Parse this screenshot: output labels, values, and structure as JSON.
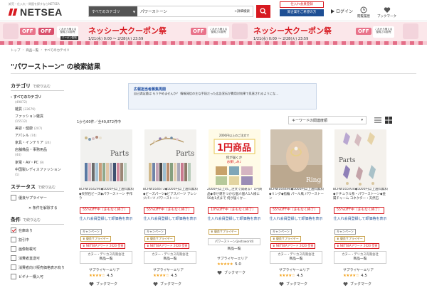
{
  "header": {
    "tagline": "卸売・仕入れ・問屋を探すならNETSEA",
    "logo": "NETSEA",
    "search_category": "すべてのカテゴリ",
    "search_value": "パワーストーン",
    "advanced_search": "+詳細検索",
    "register_top": "仕入れ会員登録",
    "register_bottom": "卸企業をご希望の方",
    "login": "ログイン",
    "history": "閲覧履歴",
    "bookmark": "ブックマーク"
  },
  "banner": {
    "off_label": "OFF",
    "coupon_title": "ネッシー大クーポン祭",
    "coupon_date": "1/21(水) 0:00 ～ 2/28(火) 23:59",
    "tag_text": "これから使える優秀さの卸売",
    "tag_foot": "クーポン配布"
  },
  "breadcrumb": [
    "トップ",
    "商品一覧",
    "すべてのカテゴリ"
  ],
  "page_title": "\"パワーストーン\" の検索結果",
  "sidebar": {
    "category_heading": "カテゴリ",
    "category_sub": "で絞り込む",
    "all_categories": "すべてのカテゴリ",
    "all_count": "(49872)",
    "categories": [
      {
        "label": "雑貨",
        "count": "(33679)"
      },
      {
        "label": "ファッション雑貨",
        "count": "(15512)"
      },
      {
        "label": "美容・健康",
        "count": "(207)"
      },
      {
        "label": "アパレル",
        "count": "(74)"
      },
      {
        "label": "家具・インテリア",
        "count": "(24)"
      },
      {
        "label": "店舗備品・事務用品",
        "count": "(44)"
      },
      {
        "label": "家電・AV・PC",
        "count": "(9)"
      },
      {
        "label": "中国製レディスファッション",
        "count": "(1)"
      }
    ],
    "status_heading": "ステータス",
    "status_sub": "で絞り込む",
    "preferred_supplier": "優良サプライヤー",
    "condition_toggle": "条件を解除する",
    "conditions_heading": "条件",
    "conditions_sub": "で絞り込む",
    "conditions": [
      {
        "label": "在庫あり",
        "checked": true
      },
      {
        "label": "割引中",
        "checked": false
      },
      {
        "label": "画像転載可",
        "checked": false
      },
      {
        "label": "消費者直送可",
        "checked": false
      },
      {
        "label": "消費者向け販売価格表示有り",
        "checked": false
      },
      {
        "label": "ビギナー購入可",
        "checked": false
      }
    ]
  },
  "ad": {
    "title": "広報担当者募集再開",
    "desc": "自己満足量は もうやめませんか？ 情報発信の主な手段だった広告宣伝が費用対効果で見直されるようにな..."
  },
  "results": {
    "count_text": "1から60件／全49,872件中",
    "sort_label": "キーワードの関連度順"
  },
  "products": [
    {
      "name": "BLHW164294◆5000円以上送料無料◆天然石ビーズ◆パワーストーン 手作り",
      "sale": "55%OFF中（まもなく終了）",
      "member": "仕入れ会員登録して卸価格を表示",
      "tag1": "キャンペーン",
      "tag2": "優良サプライヤー",
      "tag3": "NETSEAアワード 2020 受賞",
      "shop_name": "カヌー・デリカス有限会社",
      "shop_button": "商品一覧",
      "supplier": "サプライヤーエリア",
      "rating": "4.5",
      "bookmark": "ブックマーク"
    },
    {
      "name": "BLHW164673◆5000円以上送料無料◆ビーズパーツ◆ビアスパーツ アレンジパーツ パワーストーン",
      "sale": "55%OFF中（まもなく終了）",
      "member": "仕入れ会員登録して卸価格を表示",
      "tag1": "キャンペーン",
      "tag2": "優良サプライヤー",
      "tag3": "NETSEAアワード 2020 受賞",
      "shop_name": "カヌー・デリカス有限会社",
      "shop_button": "商品一覧",
      "supplier": "サプライヤーエリア",
      "rating": "4.5",
      "bookmark": "ブックマーク"
    },
    {
      "name": "2000円以上のご注文で開運る！1円商品◆幸せ運をつかむ個人個人1人様に50お1点まで 何が届くか...",
      "sale": "10%OFF中（まもなく終了）",
      "member": "仕入れ会員登録して卸価格を表示",
      "tag1": "優良サプライヤー",
      "tag2": "パワーストーン(jestsworld)",
      "tag3": "",
      "shop_name": "",
      "shop_button": "商品一覧",
      "supplier": "サプライヤーエリア",
      "rating": "5.0",
      "bookmark": "ブックマーク"
    },
    {
      "name": "BLHW164494◆5000円以上送料無料◆リング◆指輪 パール風 パワーストーン",
      "sale": "55%OFF中（まもなく終了）",
      "member": "仕入れ会員登録して卸価格を表示",
      "tag1": "キャンペーン",
      "tag2": "優良サプライヤー",
      "tag3": "NETSEAアワード 2020 受賞",
      "shop_name": "カヌー・デリカス有限会社",
      "shop_button": "商品一覧",
      "supplier": "サプライヤーエリア",
      "rating": "4.5",
      "bookmark": "ブックマーク"
    },
    {
      "name": "BLHW165934◆5000円以上送料無料◆ナチュラル系・パワーストーン◆金属チャーム コネクター・天然石",
      "sale": "55%OFF中（まもなく終了）",
      "member": "仕入れ会員登録して卸価格を表示",
      "tag1": "キャンペーン",
      "tag2": "優良サプライヤー",
      "tag3": "NETSEAアワード 2020 受賞",
      "shop_name": "カヌー・デリカス有限会社",
      "shop_button": "商品一覧",
      "supplier": "サプライヤーエリア",
      "rating": "4.5",
      "bookmark": "ブックマーク"
    }
  ],
  "image_labels": {
    "parts": "Parts",
    "ring": "Ring",
    "one_yen_title": "1円商品",
    "one_yen_top": "2000円以上のご注文で",
    "one_yen_sub": "何が届くか",
    "one_yen_sub2": "お楽しみ♪"
  },
  "colors": {
    "brand_red": "#d71920",
    "navy": "#1e4f94",
    "banner_pink": "#fbe7ea",
    "star": "#f3a21b"
  }
}
